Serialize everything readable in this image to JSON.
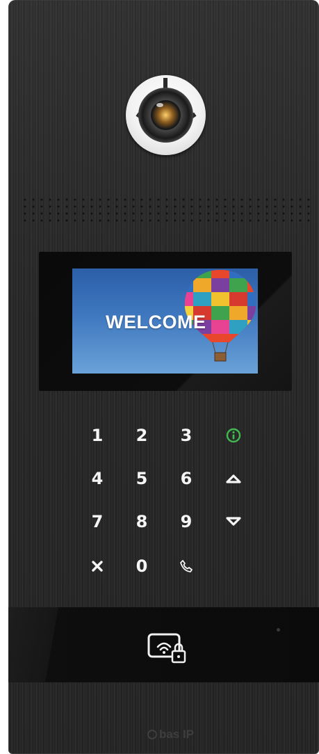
{
  "device": {
    "screen_text": "WELCOME",
    "brand": "bas IP",
    "accent_info_color": "#3fb950",
    "panel_color": "#2a2a2a"
  },
  "keypad": {
    "keys": [
      {
        "label": "1",
        "icon": null
      },
      {
        "label": "2",
        "icon": null
      },
      {
        "label": "3",
        "icon": null
      },
      {
        "label": "",
        "icon": "info-icon"
      },
      {
        "label": "4",
        "icon": null
      },
      {
        "label": "5",
        "icon": null
      },
      {
        "label": "6",
        "icon": null
      },
      {
        "label": "",
        "icon": "chevron-up-icon"
      },
      {
        "label": "7",
        "icon": null
      },
      {
        "label": "8",
        "icon": null
      },
      {
        "label": "9",
        "icon": null
      },
      {
        "label": "",
        "icon": "chevron-down-icon"
      },
      {
        "label": "",
        "icon": "cancel-x-icon"
      },
      {
        "label": "0",
        "icon": null
      },
      {
        "label": "",
        "icon": "call-phone-icon"
      }
    ]
  },
  "reader": {
    "icon": "nfc-card-lock-icon"
  }
}
